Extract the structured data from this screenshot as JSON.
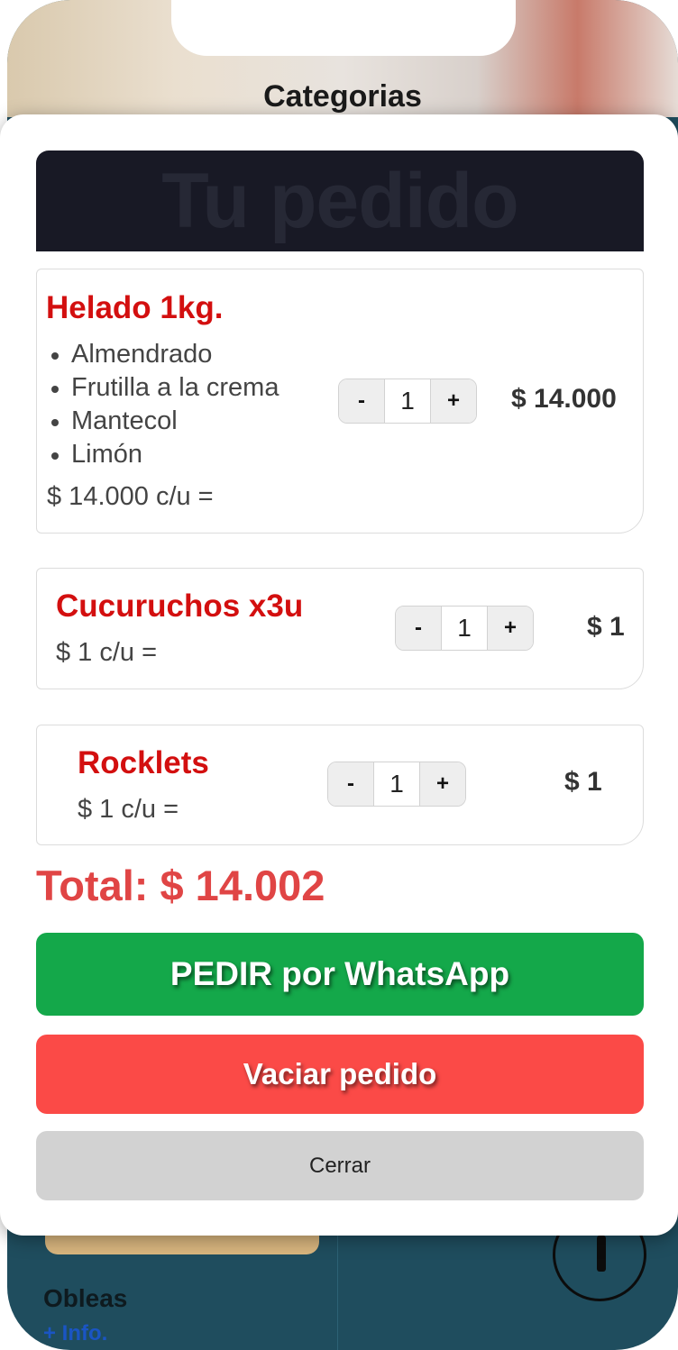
{
  "background": {
    "title": "Categorias",
    "card_title": "Obleas",
    "card_link": "+ Info."
  },
  "modal": {
    "title": "Tu pedido",
    "items": [
      {
        "name": "Helado 1kg.",
        "flavors": [
          "Almendrado",
          "Frutilla a la crema",
          "Mantecol",
          "Limón"
        ],
        "unit_price": "$ 14.000 c/u =",
        "quantity": "1",
        "subtotal": "$ 14.000"
      },
      {
        "name": "Cucuruchos x3u",
        "unit_price": "$ 1 c/u =",
        "quantity": "1",
        "subtotal": "$ 1"
      },
      {
        "name": "Rocklets",
        "unit_price": "$ 1 c/u =",
        "quantity": "1",
        "subtotal": "$ 1"
      }
    ],
    "qty_minus": "-",
    "qty_plus": "+",
    "total": "Total: $ 14.002",
    "order_whatsapp_label": "PEDIR por WhatsApp",
    "empty_order_label": "Vaciar pedido",
    "close_label": "Cerrar"
  },
  "colors": {
    "item_name": "#d30f0f",
    "total": "#e04545",
    "whatsapp_button": "#14a84a",
    "empty_button": "#fb4a47",
    "close_button": "#d2d2d2",
    "header": "#181925"
  }
}
